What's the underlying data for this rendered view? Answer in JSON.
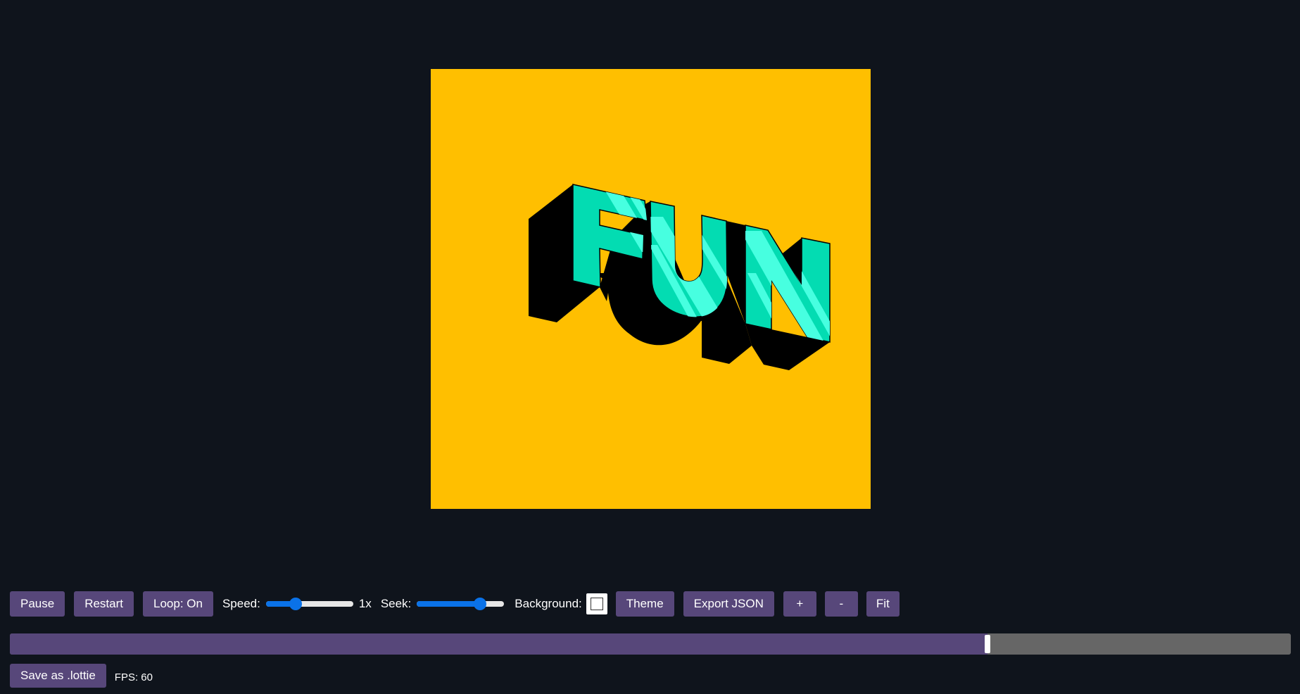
{
  "animation": {
    "text": "FUN",
    "background_color": "#ffbf00",
    "letter_color": "#03dcb2",
    "stripe_color": "#47ffe0",
    "shadow_color": "#000000"
  },
  "controls": {
    "pause_label": "Pause",
    "restart_label": "Restart",
    "loop_label": "Loop: On",
    "speed_label": "Speed:",
    "speed_value": "1x",
    "speed_fraction": 0.34,
    "seek_label": "Seek:",
    "seek_fraction": 0.72,
    "background_label": "Background:",
    "background_value": "#ffffff",
    "theme_label": "Theme",
    "export_label": "Export JSON",
    "zoom_in_label": "+",
    "zoom_out_label": "-",
    "fit_label": "Fit"
  },
  "timeline": {
    "progress": 0.763
  },
  "footer": {
    "save_label": "Save as .lottie",
    "fps_text": "FPS: 60"
  },
  "colors": {
    "page_bg": "#0f141c",
    "button_bg": "#57477a",
    "slider_accent": "#0a72e8",
    "timeline_track": "#666666"
  }
}
